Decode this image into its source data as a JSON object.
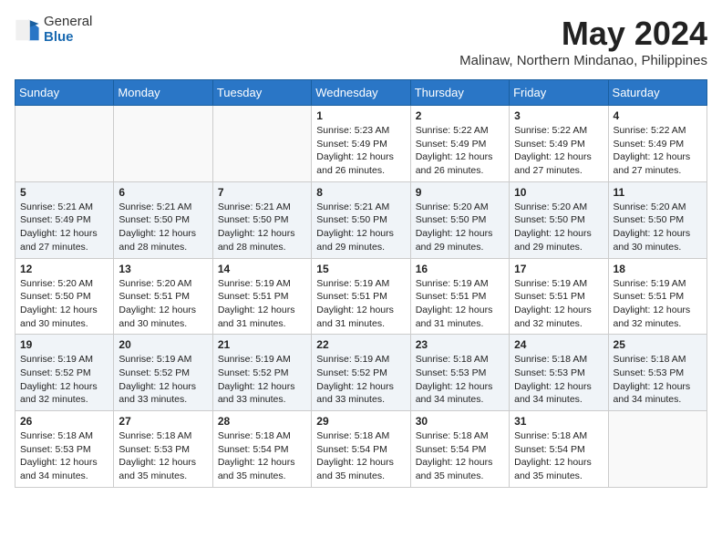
{
  "logo": {
    "general": "General",
    "blue": "Blue"
  },
  "title": "May 2024",
  "location": "Malinaw, Northern Mindanao, Philippines",
  "days_of_week": [
    "Sunday",
    "Monday",
    "Tuesday",
    "Wednesday",
    "Thursday",
    "Friday",
    "Saturday"
  ],
  "weeks": [
    [
      {
        "day": "",
        "info": ""
      },
      {
        "day": "",
        "info": ""
      },
      {
        "day": "",
        "info": ""
      },
      {
        "day": "1",
        "info": "Sunrise: 5:23 AM\nSunset: 5:49 PM\nDaylight: 12 hours\nand 26 minutes."
      },
      {
        "day": "2",
        "info": "Sunrise: 5:22 AM\nSunset: 5:49 PM\nDaylight: 12 hours\nand 26 minutes."
      },
      {
        "day": "3",
        "info": "Sunrise: 5:22 AM\nSunset: 5:49 PM\nDaylight: 12 hours\nand 27 minutes."
      },
      {
        "day": "4",
        "info": "Sunrise: 5:22 AM\nSunset: 5:49 PM\nDaylight: 12 hours\nand 27 minutes."
      }
    ],
    [
      {
        "day": "5",
        "info": "Sunrise: 5:21 AM\nSunset: 5:49 PM\nDaylight: 12 hours\nand 27 minutes."
      },
      {
        "day": "6",
        "info": "Sunrise: 5:21 AM\nSunset: 5:50 PM\nDaylight: 12 hours\nand 28 minutes."
      },
      {
        "day": "7",
        "info": "Sunrise: 5:21 AM\nSunset: 5:50 PM\nDaylight: 12 hours\nand 28 minutes."
      },
      {
        "day": "8",
        "info": "Sunrise: 5:21 AM\nSunset: 5:50 PM\nDaylight: 12 hours\nand 29 minutes."
      },
      {
        "day": "9",
        "info": "Sunrise: 5:20 AM\nSunset: 5:50 PM\nDaylight: 12 hours\nand 29 minutes."
      },
      {
        "day": "10",
        "info": "Sunrise: 5:20 AM\nSunset: 5:50 PM\nDaylight: 12 hours\nand 29 minutes."
      },
      {
        "day": "11",
        "info": "Sunrise: 5:20 AM\nSunset: 5:50 PM\nDaylight: 12 hours\nand 30 minutes."
      }
    ],
    [
      {
        "day": "12",
        "info": "Sunrise: 5:20 AM\nSunset: 5:50 PM\nDaylight: 12 hours\nand 30 minutes."
      },
      {
        "day": "13",
        "info": "Sunrise: 5:20 AM\nSunset: 5:51 PM\nDaylight: 12 hours\nand 30 minutes."
      },
      {
        "day": "14",
        "info": "Sunrise: 5:19 AM\nSunset: 5:51 PM\nDaylight: 12 hours\nand 31 minutes."
      },
      {
        "day": "15",
        "info": "Sunrise: 5:19 AM\nSunset: 5:51 PM\nDaylight: 12 hours\nand 31 minutes."
      },
      {
        "day": "16",
        "info": "Sunrise: 5:19 AM\nSunset: 5:51 PM\nDaylight: 12 hours\nand 31 minutes."
      },
      {
        "day": "17",
        "info": "Sunrise: 5:19 AM\nSunset: 5:51 PM\nDaylight: 12 hours\nand 32 minutes."
      },
      {
        "day": "18",
        "info": "Sunrise: 5:19 AM\nSunset: 5:51 PM\nDaylight: 12 hours\nand 32 minutes."
      }
    ],
    [
      {
        "day": "19",
        "info": "Sunrise: 5:19 AM\nSunset: 5:52 PM\nDaylight: 12 hours\nand 32 minutes."
      },
      {
        "day": "20",
        "info": "Sunrise: 5:19 AM\nSunset: 5:52 PM\nDaylight: 12 hours\nand 33 minutes."
      },
      {
        "day": "21",
        "info": "Sunrise: 5:19 AM\nSunset: 5:52 PM\nDaylight: 12 hours\nand 33 minutes."
      },
      {
        "day": "22",
        "info": "Sunrise: 5:19 AM\nSunset: 5:52 PM\nDaylight: 12 hours\nand 33 minutes."
      },
      {
        "day": "23",
        "info": "Sunrise: 5:18 AM\nSunset: 5:53 PM\nDaylight: 12 hours\nand 34 minutes."
      },
      {
        "day": "24",
        "info": "Sunrise: 5:18 AM\nSunset: 5:53 PM\nDaylight: 12 hours\nand 34 minutes."
      },
      {
        "day": "25",
        "info": "Sunrise: 5:18 AM\nSunset: 5:53 PM\nDaylight: 12 hours\nand 34 minutes."
      }
    ],
    [
      {
        "day": "26",
        "info": "Sunrise: 5:18 AM\nSunset: 5:53 PM\nDaylight: 12 hours\nand 34 minutes."
      },
      {
        "day": "27",
        "info": "Sunrise: 5:18 AM\nSunset: 5:53 PM\nDaylight: 12 hours\nand 35 minutes."
      },
      {
        "day": "28",
        "info": "Sunrise: 5:18 AM\nSunset: 5:54 PM\nDaylight: 12 hours\nand 35 minutes."
      },
      {
        "day": "29",
        "info": "Sunrise: 5:18 AM\nSunset: 5:54 PM\nDaylight: 12 hours\nand 35 minutes."
      },
      {
        "day": "30",
        "info": "Sunrise: 5:18 AM\nSunset: 5:54 PM\nDaylight: 12 hours\nand 35 minutes."
      },
      {
        "day": "31",
        "info": "Sunrise: 5:18 AM\nSunset: 5:54 PM\nDaylight: 12 hours\nand 35 minutes."
      },
      {
        "day": "",
        "info": ""
      }
    ]
  ]
}
